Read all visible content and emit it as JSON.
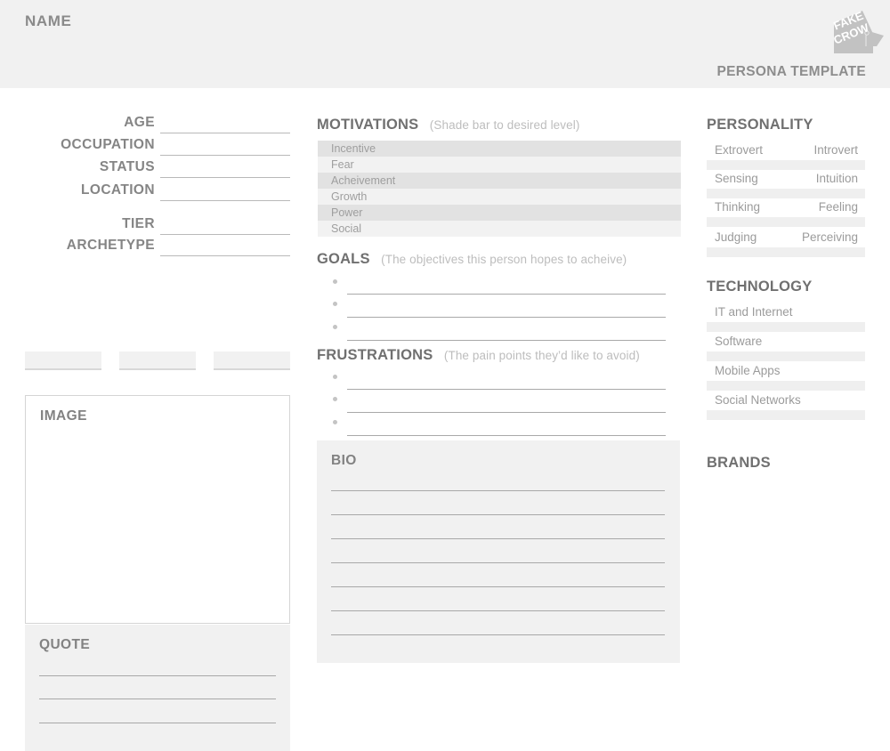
{
  "header": {
    "name_label": "NAME",
    "template_title": "PERSONA TEMPLATE",
    "logo_name": "fakecrow-logo",
    "logo_text_top": "FAKE",
    "logo_text_bottom": "CROW",
    "background_color": "#f1f1f1"
  },
  "left_column": {
    "fields": [
      {
        "label": "AGE"
      },
      {
        "label": "OCCUPATION"
      },
      {
        "label": "STATUS"
      },
      {
        "label": "LOCATION"
      },
      {
        "label": "TIER"
      },
      {
        "label": "ARCHETYPE"
      }
    ],
    "tags": [
      {
        "value": ""
      },
      {
        "value": ""
      },
      {
        "value": ""
      }
    ],
    "image_box": {
      "heading": "IMAGE"
    },
    "quote_box": {
      "heading": "QUOTE",
      "line_count": 3
    }
  },
  "center_column": {
    "motivations": {
      "title": "MOTIVATIONS",
      "hint": "(Shade bar to desired level)",
      "items": [
        {
          "label": "Incentive"
        },
        {
          "label": "Fear"
        },
        {
          "label": "Acheivement"
        },
        {
          "label": "Growth"
        },
        {
          "label": "Power"
        },
        {
          "label": "Social"
        }
      ]
    },
    "goals": {
      "title": "GOALS",
      "hint": "(The objectives this person hopes to acheive)",
      "line_count": 3
    },
    "frustrations": {
      "title": "FRUSTRATIONS",
      "hint": "(The pain points they’d like to avoid)",
      "line_count": 3
    },
    "bio": {
      "heading": "BIO",
      "line_count": 7
    }
  },
  "right_column": {
    "personality": {
      "title": "PERSONALITY",
      "pairs": [
        {
          "left": "Extrovert",
          "right": "Introvert"
        },
        {
          "left": "Sensing",
          "right": "Intuition"
        },
        {
          "left": "Thinking",
          "right": "Feeling"
        },
        {
          "left": "Judging",
          "right": "Perceiving"
        }
      ]
    },
    "technology": {
      "title": "TECHNOLOGY",
      "items": [
        {
          "label": "IT and Internet"
        },
        {
          "label": "Software"
        },
        {
          "label": "Mobile Apps"
        },
        {
          "label": "Social Networks"
        }
      ]
    },
    "brands": {
      "title": "BRANDS"
    }
  },
  "colors": {
    "page_background": "#ffffff",
    "panel_gray": "#f1f1f1",
    "row_dark": "#e2e2e2",
    "row_light": "#f2f2f2",
    "heading_text": "#707070",
    "label_text": "#9b9b9b",
    "hint_text": "#bdbdbd",
    "rule_line": "#a8a8a8"
  }
}
